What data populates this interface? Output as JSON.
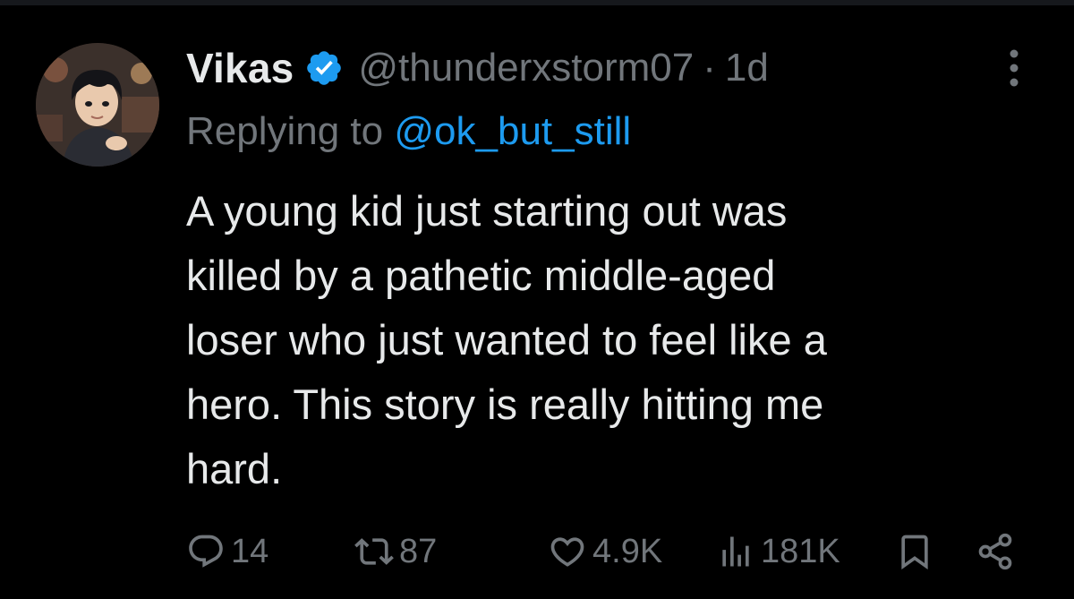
{
  "tweet": {
    "author": {
      "display_name": "Vikas",
      "handle": "@thunderxstorm07",
      "verified_icon": "verified-badge-icon",
      "avatar": "avatar-illustration"
    },
    "separator": "·",
    "time": "1d",
    "reply_prefix": "Replying to",
    "reply_to": "@ok_but_still",
    "text_lines": [
      "A young kid just starting out was",
      "killed by a pathetic middle-aged",
      "loser who just wanted to feel like a",
      "hero. This story is really hitting me",
      "hard."
    ],
    "actions": {
      "replies": "14",
      "retweets": "87",
      "likes": "4.9K",
      "views": "181K"
    }
  },
  "colors": {
    "background": "#000000",
    "primary_text": "#e7e9ea",
    "secondary_text": "#71767b",
    "accent": "#1d9bf0"
  },
  "icons": {
    "more": "more-vertical-icon",
    "reply": "reply-bubble-icon",
    "retweet": "retweet-icon",
    "like": "heart-icon",
    "views": "views-bar-chart-icon",
    "bookmark": "bookmark-icon",
    "share": "share-icon"
  }
}
